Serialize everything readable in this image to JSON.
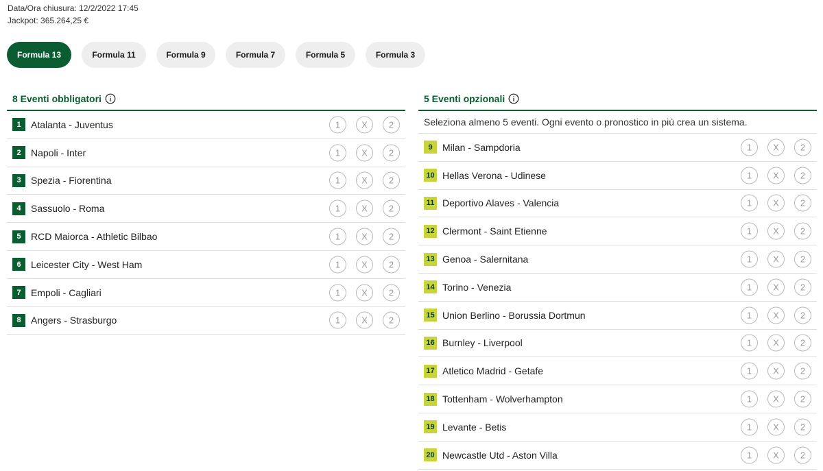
{
  "info": {
    "closing": "Data/Ora chiusura: 12/2/2022 17:45",
    "jackpot": "Jackpot: 365.264,25 €"
  },
  "tabs": [
    {
      "label": "Formula 13",
      "active": true
    },
    {
      "label": "Formula 11",
      "active": false
    },
    {
      "label": "Formula 9",
      "active": false
    },
    {
      "label": "Formula 7",
      "active": false
    },
    {
      "label": "Formula 5",
      "active": false
    },
    {
      "label": "Formula 3",
      "active": false
    }
  ],
  "mandatory": {
    "title": "8 Eventi obbligatori",
    "events": [
      {
        "num": "1",
        "match": "Atalanta - Juventus"
      },
      {
        "num": "2",
        "match": "Napoli - Inter"
      },
      {
        "num": "3",
        "match": "Spezia - Fiorentina"
      },
      {
        "num": "4",
        "match": "Sassuolo - Roma"
      },
      {
        "num": "5",
        "match": "RCD Maiorca - Athletic Bilbao"
      },
      {
        "num": "6",
        "match": "Leicester City - West Ham"
      },
      {
        "num": "7",
        "match": "Empoli - Cagliari"
      },
      {
        "num": "8",
        "match": "Angers - Strasburgo"
      }
    ]
  },
  "optional": {
    "title": "5 Eventi opzionali",
    "subtitle": "Seleziona almeno 5 eventi. Ogni evento o pronostico in più crea un sistema.",
    "events": [
      {
        "num": "9",
        "match": "Milan - Sampdoria"
      },
      {
        "num": "10",
        "match": "Hellas Verona - Udinese"
      },
      {
        "num": "11",
        "match": "Deportivo Alaves - Valencia"
      },
      {
        "num": "12",
        "match": "Clermont - Saint Etienne"
      },
      {
        "num": "13",
        "match": "Genoa - Salernitana"
      },
      {
        "num": "14",
        "match": "Torino - Venezia"
      },
      {
        "num": "15",
        "match": "Union Berlino - Borussia Dortmun"
      },
      {
        "num": "16",
        "match": "Burnley - Liverpool"
      },
      {
        "num": "17",
        "match": "Atletico Madrid - Getafe"
      },
      {
        "num": "18",
        "match": "Tottenham - Wolverhampton"
      },
      {
        "num": "19",
        "match": "Levante - Betis"
      },
      {
        "num": "20",
        "match": "Newcastle Utd - Aston Villa"
      }
    ]
  },
  "choices": [
    "1",
    "X",
    "2"
  ],
  "colors": {
    "brand_green": "#0b5c30",
    "optional_badge": "#c8d43a",
    "tab_inactive": "#eeeeee"
  }
}
